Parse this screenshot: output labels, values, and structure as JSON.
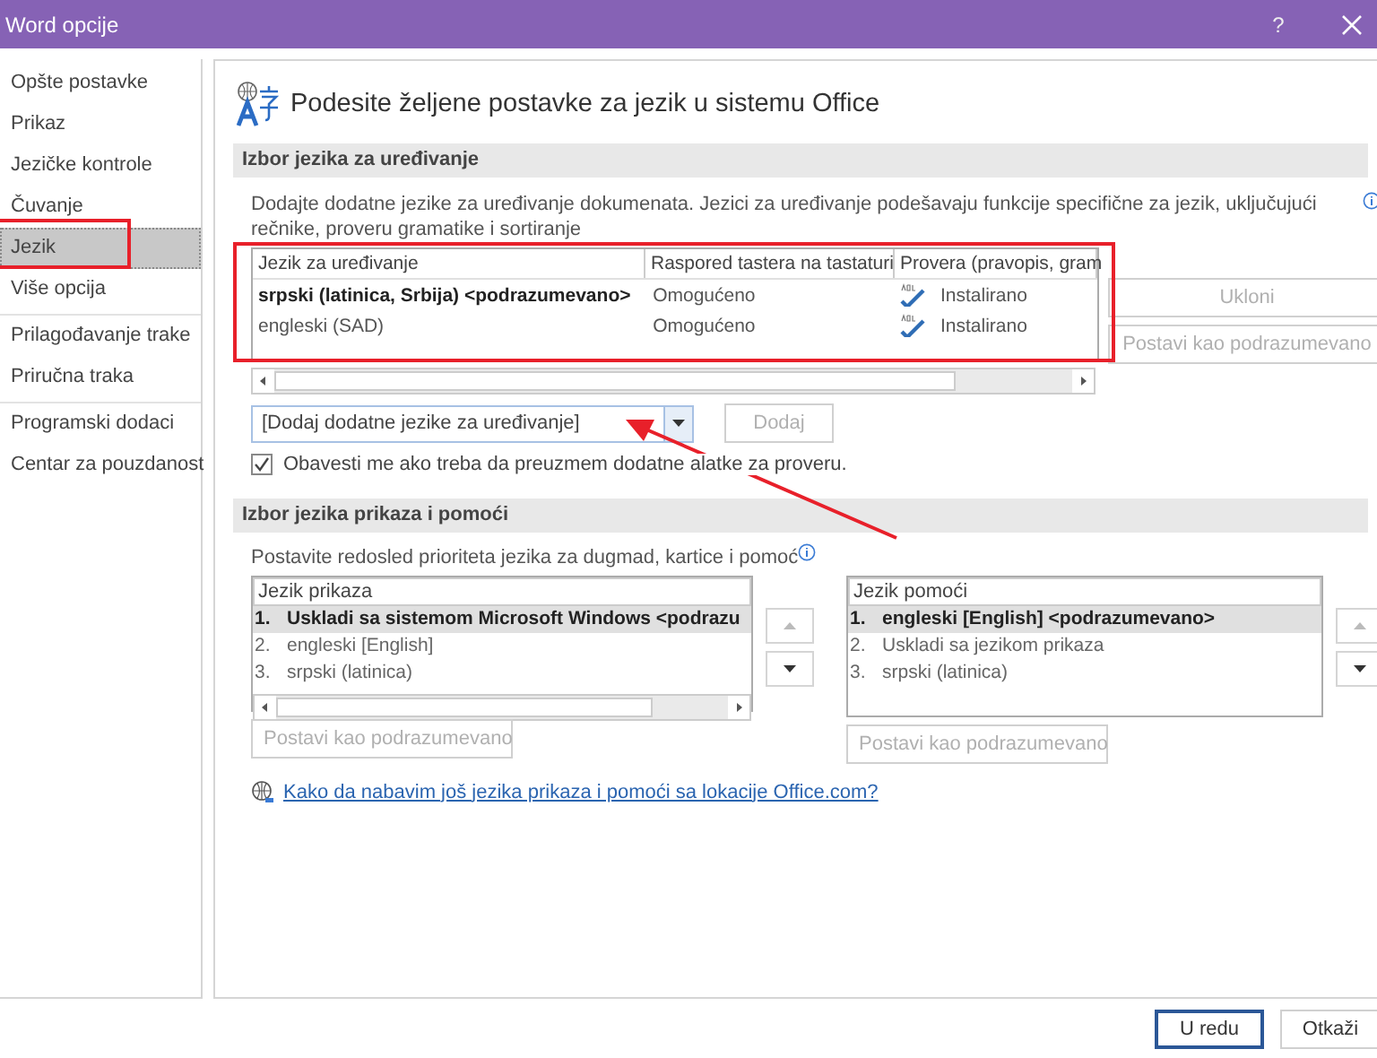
{
  "window": {
    "title": "Word opcije",
    "help": "?"
  },
  "sidebar": {
    "groups": [
      [
        {
          "label": "Opšte postavke",
          "selected": false
        },
        {
          "label": "Prikaz",
          "selected": false
        },
        {
          "label": "Jezičke kontrole",
          "selected": false
        },
        {
          "label": "Čuvanje",
          "selected": false
        },
        {
          "label": "Jezik",
          "selected": true
        },
        {
          "label": "Više opcija",
          "selected": false
        }
      ],
      [
        {
          "label": "Prilagođavanje trake",
          "selected": false
        },
        {
          "label": "Priručna traka",
          "selected": false
        }
      ],
      [
        {
          "label": "Programski dodaci",
          "selected": false
        },
        {
          "label": "Centar za pouzdanost",
          "selected": false
        }
      ]
    ]
  },
  "header": {
    "title": "Podesite željene postavke za jezik u sistemu Office"
  },
  "editing": {
    "heading": "Izbor jezika za uređivanje",
    "description": "Dodajte dodatne jezike za uređivanje dokumenata. Jezici za uređivanje podešavaju funkcije specifične za jezik, uključujući rečnike, proveru gramatike i sortiranje",
    "columns": [
      "Jezik za uređivanje",
      "Raspored tastera na tastaturi",
      "Provera (pravopis, gram"
    ],
    "rows": [
      {
        "language": "srpski (latinica, Srbija) <podrazumevano>",
        "keyboard": "Omogućeno",
        "proofing": "Instalirano",
        "default": true
      },
      {
        "language": "engleski (SAD)",
        "keyboard": "Omogućeno",
        "proofing": "Instalirano",
        "default": false
      }
    ],
    "side_buttons": [
      {
        "label": "Ukloni",
        "disabled": true
      },
      {
        "label": "Postavi kao podrazumevano",
        "disabled": true
      }
    ],
    "dropdown": {
      "value": "[Dodaj dodatne jezike za uređivanje]"
    },
    "add_button": {
      "label": "Dodaj",
      "disabled": true
    },
    "notify": {
      "label": "Obavesti me ako treba da preuzmem dodatne alatke za proveru.",
      "checked": true
    }
  },
  "display": {
    "heading": "Izbor jezika prikaza i pomoći",
    "description": "Postavite redosled prioriteta jezika za dugmad, kartice i pomoć",
    "lists": [
      {
        "header": "Jezik prikaza",
        "rows": [
          {
            "number": "1.",
            "label": "Uskladi sa sistemom Microsoft Windows <podrazu",
            "selected": true
          },
          {
            "number": "2.",
            "label": "engleski [English]",
            "selected": false
          },
          {
            "number": "3.",
            "label": "srpski (latinica)",
            "selected": false
          }
        ],
        "scrollbar": true,
        "up_disabled": true,
        "button": {
          "label": "Postavi kao podrazumevano",
          "disabled": true
        }
      },
      {
        "header": "Jezik pomoći",
        "rows": [
          {
            "number": "1.",
            "label": "engleski [English] <podrazumevano>",
            "selected": true
          },
          {
            "number": "2.",
            "label": "Uskladi sa jezikom prikaza",
            "selected": false
          },
          {
            "number": "3.",
            "label": "srpski (latinica)",
            "selected": false
          }
        ],
        "scrollbar": false,
        "up_disabled": true,
        "button": {
          "label": "Postavi kao podrazumevano",
          "disabled": true
        }
      }
    ],
    "link": "Kako da nabavim još jezika prikaza i pomoći sa lokacije Office.com?"
  },
  "footer": {
    "buttons": [
      {
        "label": "U redu",
        "kind": "primary"
      },
      {
        "label": "Otkaži",
        "kind": "normal"
      }
    ]
  }
}
